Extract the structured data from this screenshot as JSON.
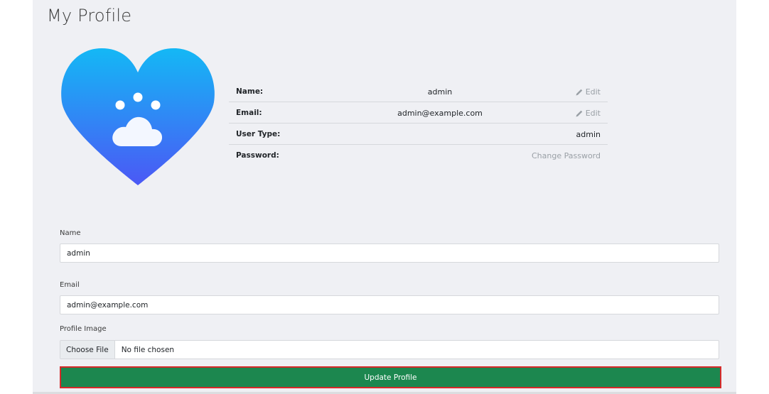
{
  "header": {
    "title": "My Profile"
  },
  "avatar": {
    "icon": "heart-paw-icon",
    "gradient_top": "#14b8f5",
    "gradient_bottom": "#4b58f5"
  },
  "profile_info": {
    "rows": [
      {
        "label": "Name:",
        "value": "admin",
        "action": "Edit"
      },
      {
        "label": "Email:",
        "value": "admin@example.com",
        "action": "Edit"
      },
      {
        "label": "User Type:",
        "value": "",
        "action": "admin"
      },
      {
        "label": "Password:",
        "value": "",
        "action": "Change Password"
      }
    ]
  },
  "form": {
    "name_label": "Name",
    "name_value": "admin",
    "email_label": "Email",
    "email_value": "admin@example.com",
    "image_label": "Profile Image",
    "choose_file_label": "Choose File",
    "file_status": "No file chosen",
    "submit_label": "Update Profile"
  },
  "colors": {
    "submit_bg": "#1c874f",
    "submit_border": "#d52a2a",
    "panel_bg": "#eff0f4"
  }
}
